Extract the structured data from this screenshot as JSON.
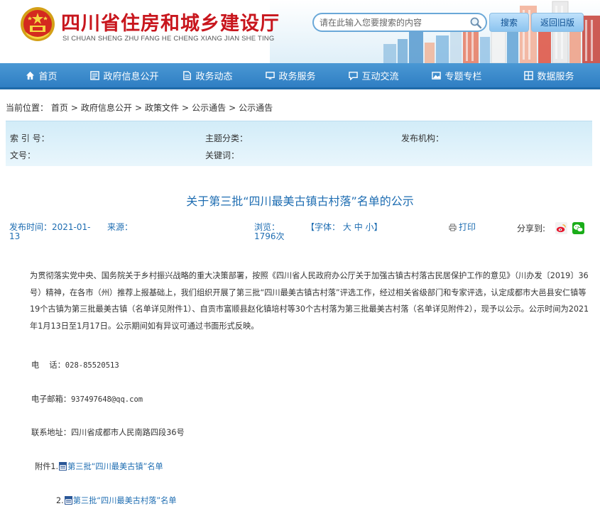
{
  "header": {
    "title": "四川省住房和城乡建设厅",
    "pinyin": "SI CHUAN SHENG ZHU FANG HE CHENG XIANG JIAN SHE TING",
    "search_placeholder": "请在此输入您要搜索的内容",
    "search_button": "搜索",
    "old_version_button": "返回旧版"
  },
  "nav": [
    {
      "label": "首页",
      "icon": "home-icon"
    },
    {
      "label": "政府信息公开",
      "icon": "list-icon"
    },
    {
      "label": "政务动态",
      "icon": "document-icon"
    },
    {
      "label": "政务服务",
      "icon": "monitor-icon"
    },
    {
      "label": "互动交流",
      "icon": "chat-icon"
    },
    {
      "label": "专题专栏",
      "icon": "image-icon"
    },
    {
      "label": "数据服务",
      "icon": "grid-icon"
    }
  ],
  "breadcrumb": {
    "prefix": "当前位置：",
    "items": [
      "首页",
      "政府信息公开",
      "政策文件",
      "公示通告",
      "公示通告"
    ],
    "separator": ">"
  },
  "meta": {
    "index_no": "索 引 号：",
    "topic": "主题分类：",
    "publisher": "发布机构：",
    "doc_no": "文号：",
    "keywords": "关键词："
  },
  "article": {
    "title": "关于第三批“四川最美古镇古村落”名单的公示",
    "publish_label": "发布时间：2021-01-",
    "publish_label_2": "13",
    "source_label": "来源：",
    "views_label": "浏览：",
    "views_count": "1796次",
    "font_label": "【字体：",
    "font_large": "大",
    "font_medium": "中",
    "font_small": "小",
    "font_close": "】",
    "print_label": "打印",
    "share_label": "分享到:",
    "paragraph_1": "为贯彻落实党中央、国务院关于乡村振兴战略的重大决策部署，按照《四川省人民政府办公厅关于加强古镇古村落古民居保护工作的意见》（川办发〔2019〕36号）精神，在各市（州）推荐上报基础上，我们组织开展了第三批“四川最美古镇古村落”评选工作，经过相关省级部门和专家评选，认定成都市大邑县安仁镇等19个古镇为第三批最美古镇（名单详见附件1）、自贡市富顺县赵化镇培村等30个古村落为第三批最美古村落（名单详见附件2），现予以公示。公示时间为2021年1月13日至1月17日。公示期间如有异议可通过书面形式反映。",
    "phone_label": "电    话：",
    "phone": "028-85520513",
    "email_label": "电子邮箱：",
    "email": "937497648@qq.com",
    "address_label": "联系地址：",
    "address": "四川省成都市人民南路四段36号",
    "attach_1_prefix": "附件1.",
    "attach_1_link": "第三批“四川最美古镇”名单",
    "attach_2_prefix": "2.",
    "attach_2_link": "第三批“四川最美古村落”名单"
  },
  "colors": {
    "brand_red": "#c8161d",
    "nav_blue": "#3a87c9",
    "link_blue": "#1e6db2"
  }
}
